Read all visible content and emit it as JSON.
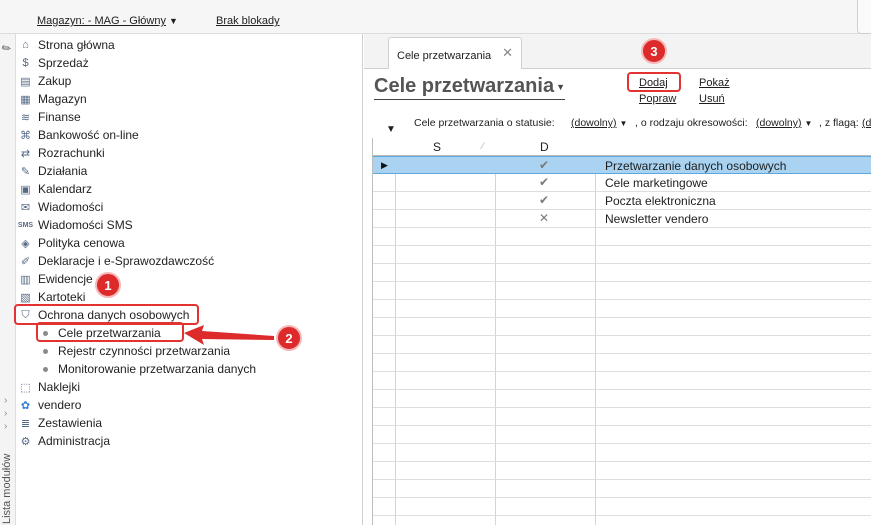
{
  "topbar": {
    "warehouse_label": "Magazyn: - MAG - Główny",
    "lock_status": "Brak blokady"
  },
  "side_strip": {
    "label": "Lista modułów"
  },
  "nav": {
    "items": [
      {
        "label": "Strona główna",
        "icon": "home-icon"
      },
      {
        "label": "Sprzedaż",
        "icon": "sales-icon"
      },
      {
        "label": "Zakup",
        "icon": "cart-icon"
      },
      {
        "label": "Magazyn",
        "icon": "warehouse-icon"
      },
      {
        "label": "Finanse",
        "icon": "finance-icon"
      },
      {
        "label": "Bankowość on-line",
        "icon": "bank-icon"
      },
      {
        "label": "Rozrachunki",
        "icon": "settlements-icon"
      },
      {
        "label": "Działania",
        "icon": "actions-icon"
      },
      {
        "label": "Kalendarz",
        "icon": "calendar-icon"
      },
      {
        "label": "Wiadomości",
        "icon": "mail-icon"
      },
      {
        "label": "Wiadomości SMS",
        "icon": "sms-icon"
      },
      {
        "label": "Polityka cenowa",
        "icon": "price-tag-icon"
      },
      {
        "label": "Deklaracje i e-Sprawozdawczość",
        "icon": "declarations-icon"
      },
      {
        "label": "Ewidencje",
        "icon": "records-icon"
      },
      {
        "label": "Kartoteki",
        "icon": "files-icon"
      },
      {
        "label": "Ochrona danych osobowych",
        "icon": "shield-icon"
      }
    ],
    "sub_items": [
      {
        "label": "Cele przetwarzania"
      },
      {
        "label": "Rejestr czynności przetwarzania"
      },
      {
        "label": "Monitorowanie przetwarzania danych"
      }
    ],
    "items_after": [
      {
        "label": "Naklejki",
        "icon": "sticker-icon"
      },
      {
        "label": "vendero",
        "icon": "vendero-icon"
      },
      {
        "label": "Zestawienia",
        "icon": "reports-icon"
      },
      {
        "label": "Administracja",
        "icon": "admin-icon"
      }
    ]
  },
  "tab": {
    "label": "Cele przetwarzania",
    "close": "✕"
  },
  "main": {
    "title": "Cele przetwarzania",
    "actions": {
      "add": "Dodaj",
      "show": "Pokaż",
      "edit": "Popraw",
      "delete": "Usuń"
    },
    "filters": {
      "status_prefix": "Cele przetwarzania o statusie:",
      "status_value": "(dowolny)",
      "period_prefix": ", o rodzaju okresowości:",
      "period_value": "(dowolny)",
      "flag_prefix": ", z flagą:",
      "flag_value": "(do"
    },
    "grid": {
      "columns": [
        "S",
        "D",
        ""
      ],
      "rows": [
        {
          "d": "✔",
          "name": "Przetwarzanie danych osobowych",
          "selected": true
        },
        {
          "d": "✔",
          "name": "Cele marketingowe",
          "selected": false
        },
        {
          "d": "✔",
          "name": "Poczta elektroniczna",
          "selected": false
        },
        {
          "d": "✕",
          "name": "Newsletter vendero",
          "selected": false
        }
      ]
    }
  },
  "annotations": {
    "badges": [
      "1",
      "2",
      "3"
    ],
    "color": "#dd2a2a"
  }
}
